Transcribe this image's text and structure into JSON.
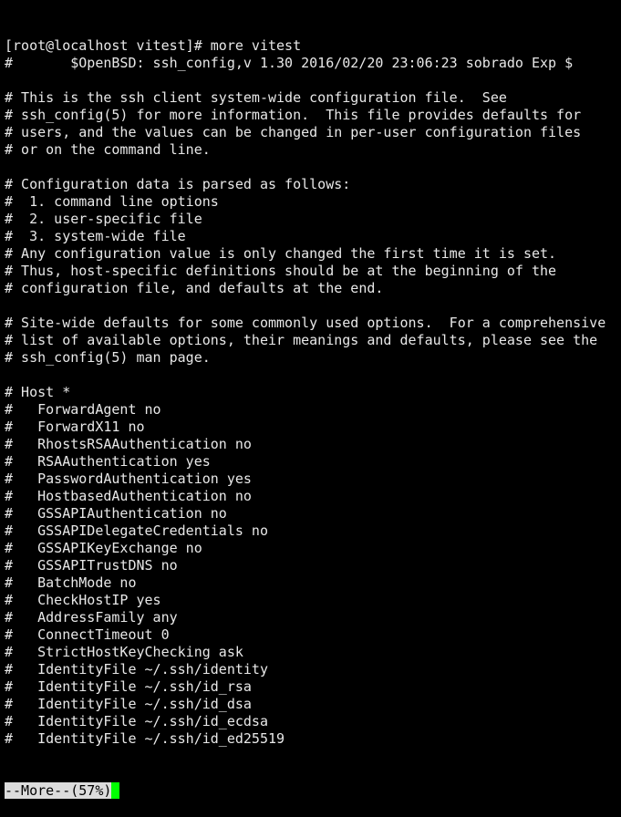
{
  "terminal": {
    "lines": [
      "[root@localhost vitest]# more vitest",
      "#       $OpenBSD: ssh_config,v 1.30 2016/02/20 23:06:23 sobrado Exp $",
      "",
      "# This is the ssh client system-wide configuration file.  See",
      "# ssh_config(5) for more information.  This file provides defaults for",
      "# users, and the values can be changed in per-user configuration files",
      "# or on the command line.",
      "",
      "# Configuration data is parsed as follows:",
      "#  1. command line options",
      "#  2. user-specific file",
      "#  3. system-wide file",
      "# Any configuration value is only changed the first time it is set.",
      "# Thus, host-specific definitions should be at the beginning of the",
      "# configuration file, and defaults at the end.",
      "",
      "# Site-wide defaults for some commonly used options.  For a comprehensive",
      "# list of available options, their meanings and defaults, please see the",
      "# ssh_config(5) man page.",
      "",
      "# Host *",
      "#   ForwardAgent no",
      "#   ForwardX11 no",
      "#   RhostsRSAAuthentication no",
      "#   RSAAuthentication yes",
      "#   PasswordAuthentication yes",
      "#   HostbasedAuthentication no",
      "#   GSSAPIAuthentication no",
      "#   GSSAPIDelegateCredentials no",
      "#   GSSAPIKeyExchange no",
      "#   GSSAPITrustDNS no",
      "#   BatchMode no",
      "#   CheckHostIP yes",
      "#   AddressFamily any",
      "#   ConnectTimeout 0",
      "#   StrictHostKeyChecking ask",
      "#   IdentityFile ~/.ssh/identity",
      "#   IdentityFile ~/.ssh/id_rsa",
      "#   IdentityFile ~/.ssh/id_dsa",
      "#   IdentityFile ~/.ssh/id_ecdsa",
      "#   IdentityFile ~/.ssh/id_ed25519"
    ],
    "pager_prompt": "--More--(57%)",
    "cursor_color": "#00ff00"
  }
}
